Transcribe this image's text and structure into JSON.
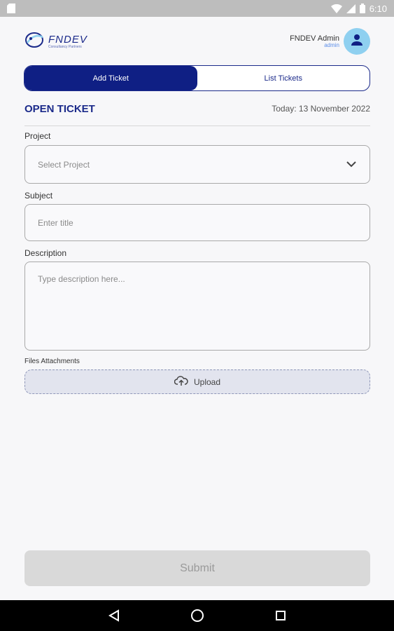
{
  "status_bar": {
    "time": "6:10"
  },
  "header": {
    "logo_title": "FNDEV",
    "logo_subtitle": "Consultancy Partners",
    "user_name": "FNDEV Admin",
    "user_role": "admin"
  },
  "tabs": [
    {
      "label": "Add Ticket",
      "active": true
    },
    {
      "label": "List Tickets",
      "active": false
    }
  ],
  "page": {
    "title": "OPEN TICKET",
    "today": "Today: 13 November 2022"
  },
  "form": {
    "project_label": "Project",
    "project_placeholder": "Select Project",
    "subject_label": "Subject",
    "subject_placeholder": "Enter title",
    "description_label": "Description",
    "description_placeholder": "Type description here...",
    "attachments_label": "Files Attachments",
    "upload_label": "Upload",
    "submit_label": "Submit"
  },
  "colors": {
    "primary": "#0f1f84",
    "accent": "#8fd0f0"
  }
}
